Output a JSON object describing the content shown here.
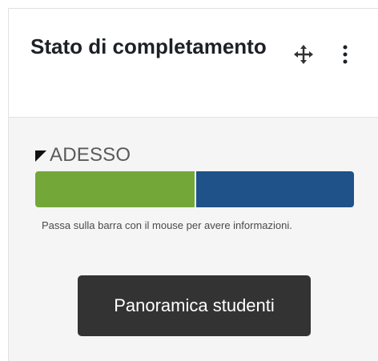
{
  "block": {
    "title": "Stato di completamento",
    "icons": {
      "move": "move-arrows-icon",
      "menu": "kebab-menu-icon"
    }
  },
  "progress": {
    "now_label": "ADESSO",
    "segments": [
      {
        "color": "#73a839",
        "fraction": 0.5
      },
      {
        "color": "#1e5289",
        "fraction": 0.5
      }
    ],
    "help_text": "Passa sulla barra con il mouse per avere informazioni."
  },
  "overview_button": {
    "label": "Panoramica studenti"
  }
}
